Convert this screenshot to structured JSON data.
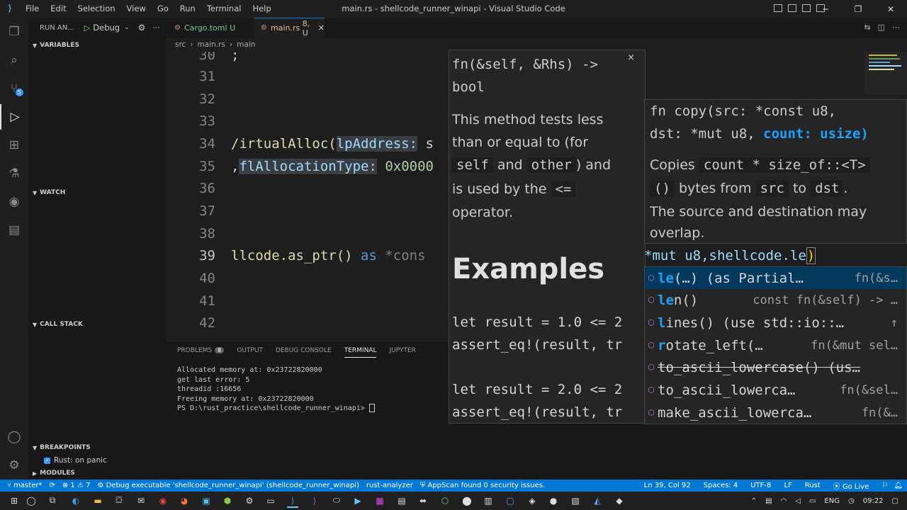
{
  "titlebar": {
    "menu": [
      "File",
      "Edit",
      "Selection",
      "View",
      "Go",
      "Run",
      "Terminal",
      "Help"
    ],
    "title": "main.rs - shellcode_runner_winapi - Visual Studio Code"
  },
  "sidebar": {
    "run_label": "RUN AN...",
    "config": "Debug",
    "sections": {
      "variables": "VARIABLES",
      "watch": "WATCH",
      "call_stack": "CALL STACK",
      "breakpoints": "BREAKPOINTS",
      "modules": "MODULES"
    },
    "breakpoint_item": "Rust: on panic"
  },
  "tabs": [
    {
      "label": "Cargo.toml",
      "status": "U"
    },
    {
      "label": "main.rs",
      "status": "8, U"
    }
  ],
  "breadcrumb": [
    "src",
    "main.rs",
    "main"
  ],
  "editor": {
    "line_numbers": [
      "30",
      "31",
      "32",
      "33",
      "34",
      "35",
      "36",
      "37",
      "38",
      "39",
      "40",
      "41",
      "42"
    ],
    "line30": ";",
    "line34_a": "/irtualAlloc(",
    "line34_b": "lpAddress:",
    "line34_c": " s",
    "line35_a": ",",
    "line35_b": "flAllocationType:",
    "line35_c": " 0x0000",
    "line39_a": "llcode.as_ptr() ",
    "line39_b": "as",
    "line39_c": " *cons"
  },
  "hover": {
    "signature_1": "fn(&self, &Rhs) ->",
    "signature_2": "bool",
    "desc_1": "This method tests less",
    "desc_2": "than or equal to (for",
    "code_self": "self",
    "and": "and",
    "code_other": "other",
    "desc_3": ") and",
    "desc_4": "is used by the",
    "code_le": "<=",
    "desc_5": "operator.",
    "examples": "Examples",
    "ex1": "let result = 1.0 <= 2",
    "ex2": "assert_eq!(result, tr",
    "ex3": "let result = 2.0 <= 2",
    "ex4": "assert_eq!(result, tr"
  },
  "signature_help": {
    "line1": "fn copy(src: *const u8,",
    "line2_a": "dst: *mut u8, ",
    "line2_b": "count: usize)",
    "d1_a": "Copies",
    "d1_code1": "count * size_of::<T>",
    "d2_code": "()",
    "d2_a": "bytes from",
    "d2_code2": "src",
    "d2_b": "to",
    "d2_code3": "dst",
    "d2_c": ".",
    "d3": "The source and destination may",
    "d4": "overlap."
  },
  "current_line": {
    "a": "*mut u8,shellcode.le",
    "b": ")"
  },
  "suggestions": [
    {
      "match": "le",
      "rest": "(…) (as Partial…",
      "detail": "fn(&s…"
    },
    {
      "match": "le",
      "rest": "n()",
      "detail": "const fn(&self) -> …"
    },
    {
      "match": "l",
      "rest": "ines() (use std::io::…",
      "detail": "↑"
    },
    {
      "match": "r",
      "rest": "otate_left(…",
      "detail": "fn(&mut sel…"
    },
    {
      "match": "",
      "rest": "to_ascii_lowercase() (us…",
      "detail": ""
    },
    {
      "match": "",
      "rest": "to_ascii_lowerca…",
      "detail": "fn(&sel…"
    },
    {
      "match": "",
      "rest": "make_ascii_lowerca…",
      "detail": "fn(&…"
    }
  ],
  "panel": {
    "tabs": [
      "PROBLEMS",
      "OUTPUT",
      "DEBUG CONSOLE",
      "TERMINAL",
      "JUPYTER"
    ],
    "problems_count": "8",
    "terminal_lines": [
      "Allocated memory at: 0x23722820000",
      "get last error: 5",
      "threadid :16656",
      "Freeing memory at: 0x23722820000",
      "PS D:\\rust_practice\\shellcode_runner_winapi> "
    ]
  },
  "statusbar": {
    "branch": "master*",
    "errors": "⊗ 1 ⚠ 7",
    "debug": "Debug executable 'shellcode_runner_winapi' (shellcode_runner_winapi)",
    "analyzer": "rust-analyzer",
    "appscan": "AppScan found 0 security issues.",
    "position": "Ln 39, Col 92",
    "spaces": "Spaces: 4",
    "encoding": "UTF-8",
    "eol": "LF",
    "language": "Rust",
    "golive": "Go Live"
  },
  "taskbar": {
    "lang": "ENG",
    "time": "09:22"
  },
  "colors": {
    "accent": "#0078d4",
    "statusbar": "#0078d4",
    "suggest_selected": "#04395e",
    "match_highlight": "#18a3ff"
  }
}
